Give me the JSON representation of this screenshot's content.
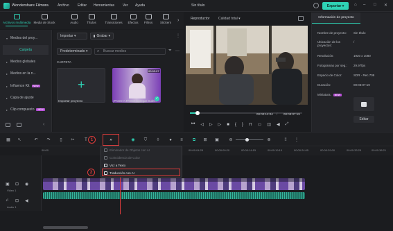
{
  "app": {
    "name": "Wondershare Filmora",
    "document_title": "Sin título",
    "menu": [
      "Archivo",
      "Editar",
      "Herramientas",
      "Ver",
      "Ayuda"
    ],
    "export_label": "Exportar"
  },
  "toolbar": {
    "items": [
      {
        "label": "Archivos multimedia",
        "icon": "media-icon",
        "active": true
      },
      {
        "label": "Media de Stock",
        "icon": "stock-media-icon"
      },
      {
        "label": "Audio",
        "icon": "audio-icon"
      },
      {
        "label": "Títulos",
        "icon": "titles-icon"
      },
      {
        "label": "Transiciones",
        "icon": "transitions-icon"
      },
      {
        "label": "Efectos",
        "icon": "effects-icon"
      },
      {
        "label": "Filtros",
        "icon": "filters-icon"
      },
      {
        "label": "Stickers",
        "icon": "stickers-icon"
      }
    ]
  },
  "sidebar": {
    "items": [
      {
        "label": "Medios del proy..."
      },
      {
        "label": "Carpeta",
        "selected": true
      },
      {
        "label": "Medios globales"
      },
      {
        "label": "Medios en la n..."
      },
      {
        "label": "Influence Kit",
        "badge": "NEW"
      },
      {
        "label": "Capa de ajuste"
      },
      {
        "label": "Clip compuesto",
        "badge": "NEW"
      }
    ]
  },
  "media": {
    "import_label": "Importar",
    "record_label": "Grabar",
    "sort_label": "Predeterminado",
    "search_placeholder": "Buscar medios",
    "folder_label": "CARPETA",
    "import_project_label": "Importar proyecto",
    "clip_label": "¡PASO A PASO! Agregar Subti...",
    "clip_duration": "00:03:07"
  },
  "player": {
    "label": "Reproductor",
    "quality": "Calidad total",
    "current_time": "00:00:12:04",
    "total_time": "00:03:07:19",
    "progress": 0.065
  },
  "properties": {
    "tab": "Información de proyecto",
    "rows": [
      {
        "k": "Nombre de proyecto:",
        "v": "Sin título"
      },
      {
        "k": "Ubicación de los proyectos:",
        "v": "/"
      },
      {
        "k": "Resolución:",
        "v": "1920 x 1080"
      },
      {
        "k": "Fotogramas por seg.:",
        "v": "29.97fps"
      },
      {
        "k": "Espacio de Color:",
        "v": "SDR - Rec.709"
      },
      {
        "k": "Duración:",
        "v": "00:03:07:19"
      },
      {
        "k": "Miniatura:",
        "v": ""
      }
    ],
    "miniatura_badge": "NEW",
    "edit_label": "Editar"
  },
  "timeline": {
    "ruler_ticks": [
      "00:00",
      "00:00:04:25",
      "00:00:09:20",
      "00:00:14:15",
      "00:00:19:10",
      "00:00:24:05",
      "00:00:29:00",
      "00:00:33:25",
      "00:00:38:21"
    ],
    "dropdown": [
      {
        "label": "Eliminador de Objetos con AI",
        "enabled": false
      },
      {
        "label": "Coincidencia de Color",
        "enabled": false
      },
      {
        "label": "Voz a Texto",
        "enabled": true
      },
      {
        "label": "Traducción con AI",
        "enabled": true
      }
    ],
    "callouts": [
      "1",
      "2"
    ],
    "tracks": [
      {
        "label": "Video 1"
      },
      {
        "label": "Audio 1"
      }
    ]
  },
  "colors": {
    "accent": "#2fd2b5",
    "callout": "#e03c3c"
  }
}
